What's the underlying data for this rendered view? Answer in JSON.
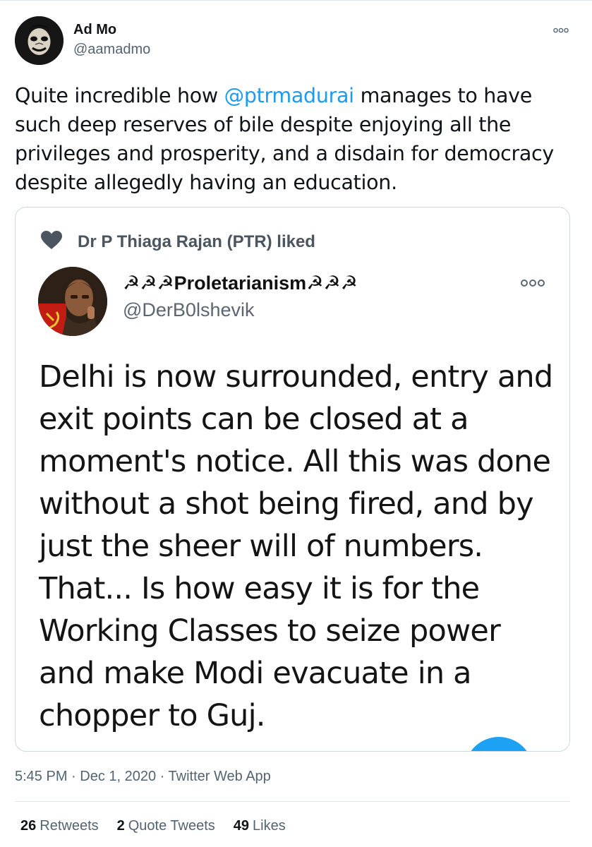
{
  "author": {
    "name": "Ad Mo",
    "handle": "@aamadmo"
  },
  "tweet": {
    "text_before": "Quite incredible how ",
    "mention": "@ptrmadurai",
    "text_after": " manages to have such deep reserves of bile despite enjoying all the privileges and prosperity, and a disdain for democracy despite allegedly having an education."
  },
  "embedded": {
    "liked_by": "Dr P Thiaga Rajan (PTR) liked",
    "name": "☭☭☭Proletarianism☭☭☭",
    "handle": "@DerB0lshevik",
    "text": "Delhi is now surrounded, entry and exit points can be closed at a moment's notice. All this was done without a shot being fired, and by just the sheer will of numbers. That... Is how easy it is for the Working Classes to seize power and make Modi evacuate in a chopper to Guj."
  },
  "meta": {
    "line": "5:45 PM · Dec 1, 2020 · Twitter Web App"
  },
  "stats": {
    "retweets_count": "26",
    "retweets_label": "Retweets",
    "quotes_count": "2",
    "quotes_label": "Quote Tweets",
    "likes_count": "49",
    "likes_label": "Likes"
  },
  "colors": {
    "accent": "#1d9bf0",
    "secondary_text": "#536471",
    "border": "#cfd9de"
  }
}
